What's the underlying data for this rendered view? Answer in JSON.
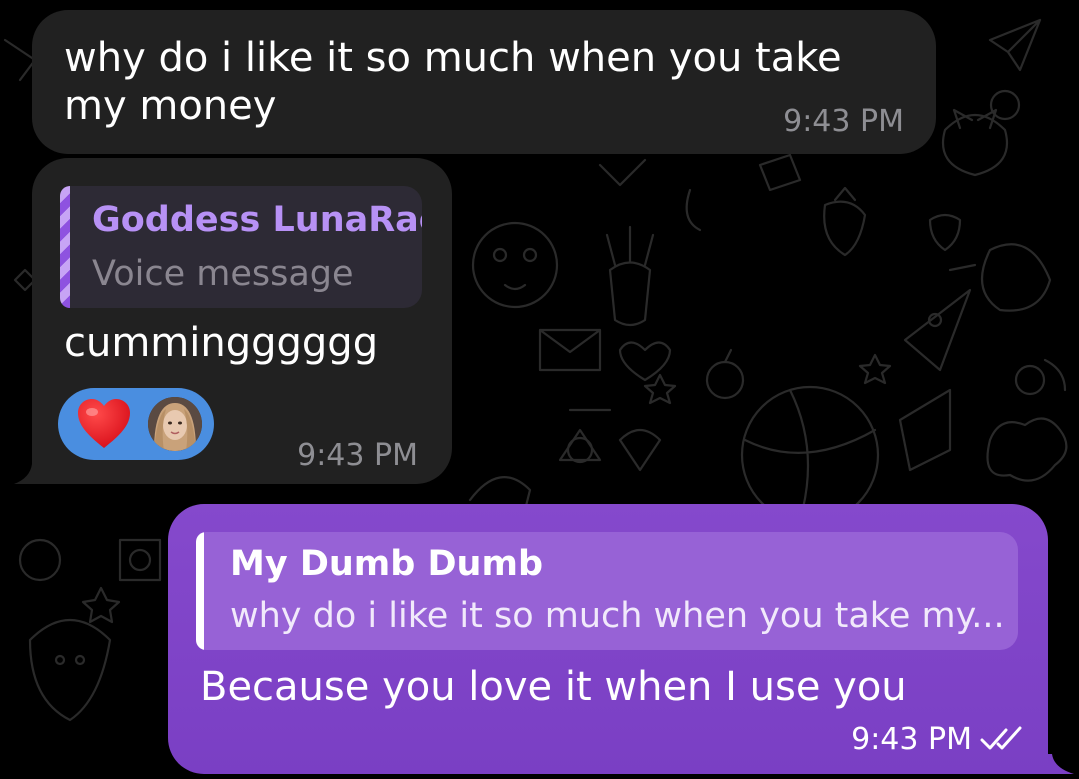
{
  "messages": [
    {
      "direction": "incoming",
      "text": "why do i like it so much when you take my money",
      "time": "9:43 PM"
    },
    {
      "direction": "incoming",
      "reply": {
        "name": "Goddess LunaRae",
        "snippet": "Voice message"
      },
      "text": "cummingggggg",
      "reaction": {
        "emoji_icon": "red-heart-icon",
        "reactor": "avatar"
      },
      "time": "9:43 PM"
    },
    {
      "direction": "outgoing",
      "reply": {
        "name": "My Dumb Dumb",
        "snippet": "why do i like it so much when you take my..."
      },
      "text": "Because you love it when I use you",
      "time": "9:43 PM",
      "status_icon": "double-check-icon"
    }
  ],
  "colors": {
    "background": "#000000",
    "incoming_bubble": "#212121",
    "outgoing_bubble": "#7f44c8",
    "reply_name_incoming": "#b791f5",
    "reaction_pill": "#4a8ee0",
    "timestamp": "#8e8e93"
  }
}
